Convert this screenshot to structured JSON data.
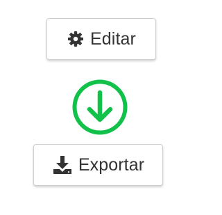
{
  "edit_button": {
    "label": "Editar",
    "icon": "gear-icon"
  },
  "flow_indicator": {
    "icon": "arrow-down-circle-icon",
    "color": "#12c14a"
  },
  "export_button": {
    "label": "Exportar",
    "icon": "download-icon"
  },
  "colors": {
    "text": "#333333",
    "border": "#cfcfcf",
    "icon": "#333333"
  }
}
